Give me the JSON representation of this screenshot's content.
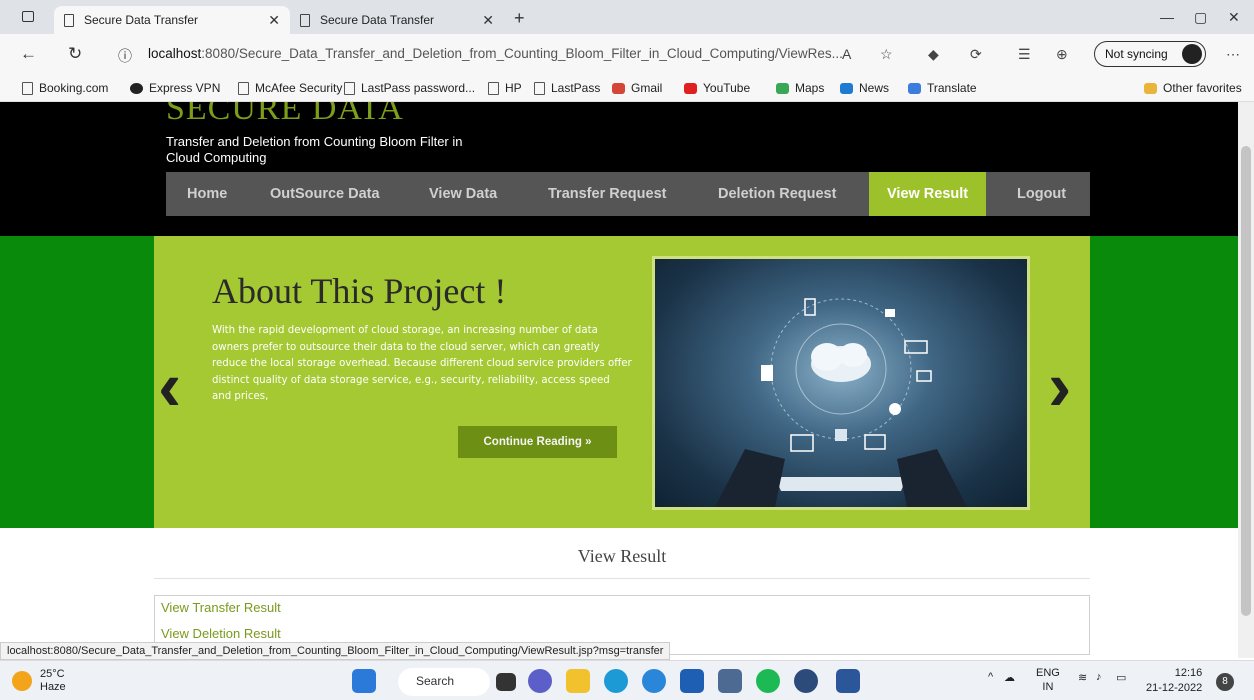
{
  "browser": {
    "tabs": [
      {
        "title": "Secure Data Transfer",
        "active": true
      },
      {
        "title": "Secure Data Transfer",
        "active": false
      }
    ],
    "url_host": "localhost",
    "url_path": ":8080/Secure_Data_Transfer_and_Deletion_from_Counting_Bloom_Filter_in_Cloud_Computing/ViewRes...",
    "sync_label": "Not syncing",
    "favorites": [
      "Booking.com",
      "Express VPN",
      "McAfee Security",
      "LastPass password...",
      "HP",
      "LastPass",
      "Gmail",
      "YouTube",
      "Maps",
      "News",
      "Translate"
    ],
    "other_favorites": "Other favorites"
  },
  "site": {
    "title": "SECURE DATA",
    "tagline": "Transfer and Deletion from Counting Bloom Filter in Cloud Computing",
    "menu": [
      "Home",
      "OutSource Data",
      "View Data",
      "Transfer Request",
      "Deletion Request",
      "View Result",
      "Logout"
    ],
    "active_menu": "View Result"
  },
  "slide": {
    "heading": "About This Project !",
    "body": "With the rapid development of cloud storage, an increasing number of data owners prefer to outsource their data to the cloud server, which can greatly reduce the local storage overhead. Because different cloud service providers offer distinct quality of data storage service, e.g., security, reliability, access speed and prices,",
    "button": "Continue Reading »"
  },
  "result": {
    "title": "View Result",
    "links": [
      "View Transfer Result",
      "View Deletion Result"
    ]
  },
  "status_url": "localhost:8080/Secure_Data_Transfer_and_Deletion_from_Counting_Bloom_Filter_in_Cloud_Computing/ViewResult.jsp?msg=transfer",
  "taskbar": {
    "temp": "25°C",
    "weather": "Haze",
    "search": "Search",
    "lang1": "ENG",
    "lang2": "IN",
    "time": "12:16",
    "date": "21-12-2022",
    "notifications": "8"
  },
  "colors": {
    "accent": "#9dc12a",
    "banner_bg": "#0a8a0a",
    "header_bg": "#000000"
  }
}
